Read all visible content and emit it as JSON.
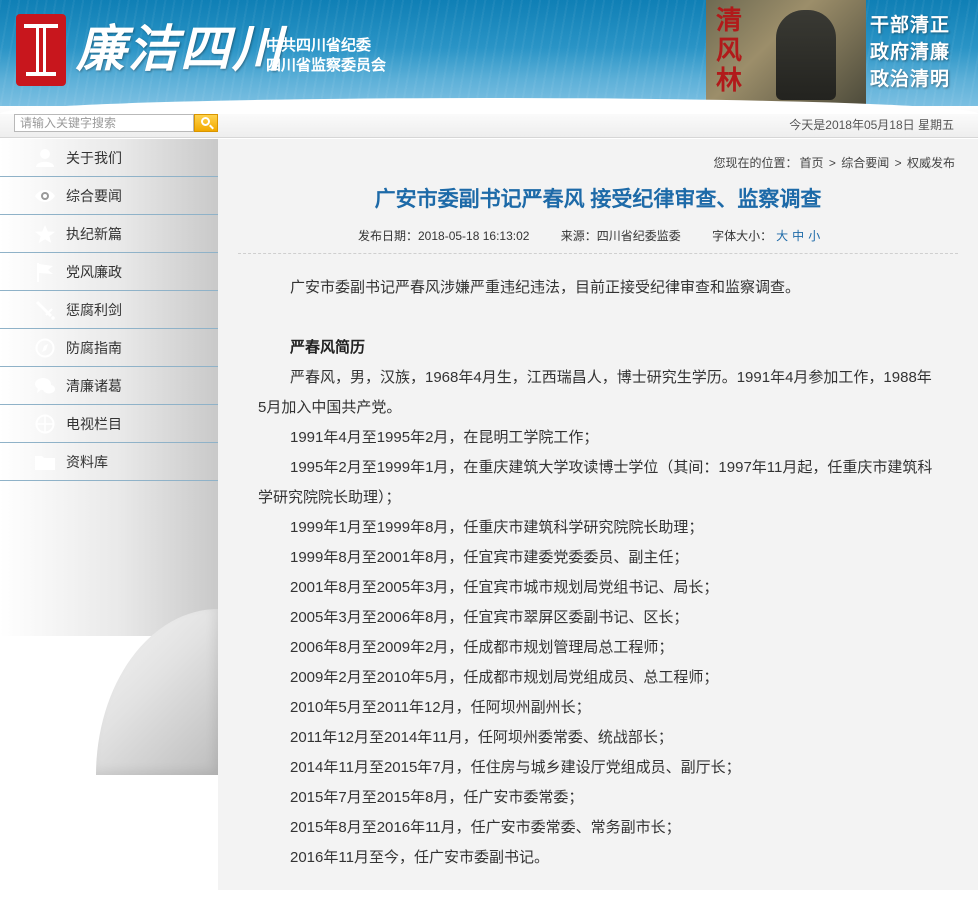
{
  "header": {
    "logo_text": "廉洁四川",
    "org_line1": "中共四川省纪委",
    "org_line2": "四川省监察委员会",
    "photo_chars": [
      "清",
      "风",
      "林"
    ],
    "slogans": [
      "干部清正",
      "政府清廉",
      "政治清明"
    ]
  },
  "search": {
    "placeholder": "请输入关键字搜索",
    "date": "今天是2018年05月18日 星期五"
  },
  "sidebar": {
    "items": [
      {
        "label": "关于我们",
        "icon": "user-icon"
      },
      {
        "label": "综合要闻",
        "icon": "eye-icon"
      },
      {
        "label": "执纪新篇",
        "icon": "star-icon"
      },
      {
        "label": "党风廉政",
        "icon": "flag-icon"
      },
      {
        "label": "惩腐利剑",
        "icon": "sword-icon"
      },
      {
        "label": "防腐指南",
        "icon": "compass-icon"
      },
      {
        "label": "清廉诸葛",
        "icon": "chat-icon"
      },
      {
        "label": "电视栏目",
        "icon": "tv-icon"
      },
      {
        "label": "资料库",
        "icon": "folder-icon"
      }
    ]
  },
  "breadcrumb": {
    "prefix": "您现在的位置：",
    "home": "首页",
    "sep": ">",
    "section": "综合要闻",
    "current": "权威发布"
  },
  "article": {
    "title": "广安市委副书记严春风 接受纪律审查、监察调查",
    "publish_date": "发布日期：2018-05-18 16:13:02",
    "source": "来源：四川省纪委监委",
    "font_size_label": "字体大小：",
    "font_sizes": [
      "大",
      "中",
      "小"
    ],
    "intro": "广安市委副书记严春风涉嫌严重违纪违法，目前正接受纪律审查和监察调查。",
    "bio_heading": "严春风简历",
    "bio_paragraphs": [
      "严春风，男，汉族，1968年4月生，江西瑞昌人，博士研究生学历。1991年4月参加工作，1988年5月加入中国共产党。",
      "1991年4月至1995年2月，在昆明工学院工作；",
      "1995年2月至1999年1月，在重庆建筑大学攻读博士学位（其间：1997年11月起，任重庆市建筑科学研究院院长助理）；",
      "1999年1月至1999年8月，任重庆市建筑科学研究院院长助理；",
      "1999年8月至2001年8月，任宜宾市建委党委委员、副主任；",
      "2001年8月至2005年3月，任宜宾市城市规划局党组书记、局长；",
      "2005年3月至2006年8月，任宜宾市翠屏区委副书记、区长；",
      "2006年8月至2009年2月，任成都市规划管理局总工程师；",
      "2009年2月至2010年5月，任成都市规划局党组成员、总工程师；",
      "2010年5月至2011年12月，任阿坝州副州长；",
      "2011年12月至2014年11月，任阿坝州委常委、统战部长；",
      "2014年11月至2015年7月，任住房与城乡建设厅党组成员、副厅长；",
      "2015年7月至2015年8月，任广安市委常委；",
      "2015年8月至2016年11月，任广安市委常委、常务副市长；",
      "2016年11月至今，任广安市委副书记。"
    ]
  },
  "colors": {
    "title_blue": "#1d6aa8",
    "banner_blue": "#0f7fb5",
    "search_button": "#f2a900",
    "seal_red": "#c8161d"
  }
}
